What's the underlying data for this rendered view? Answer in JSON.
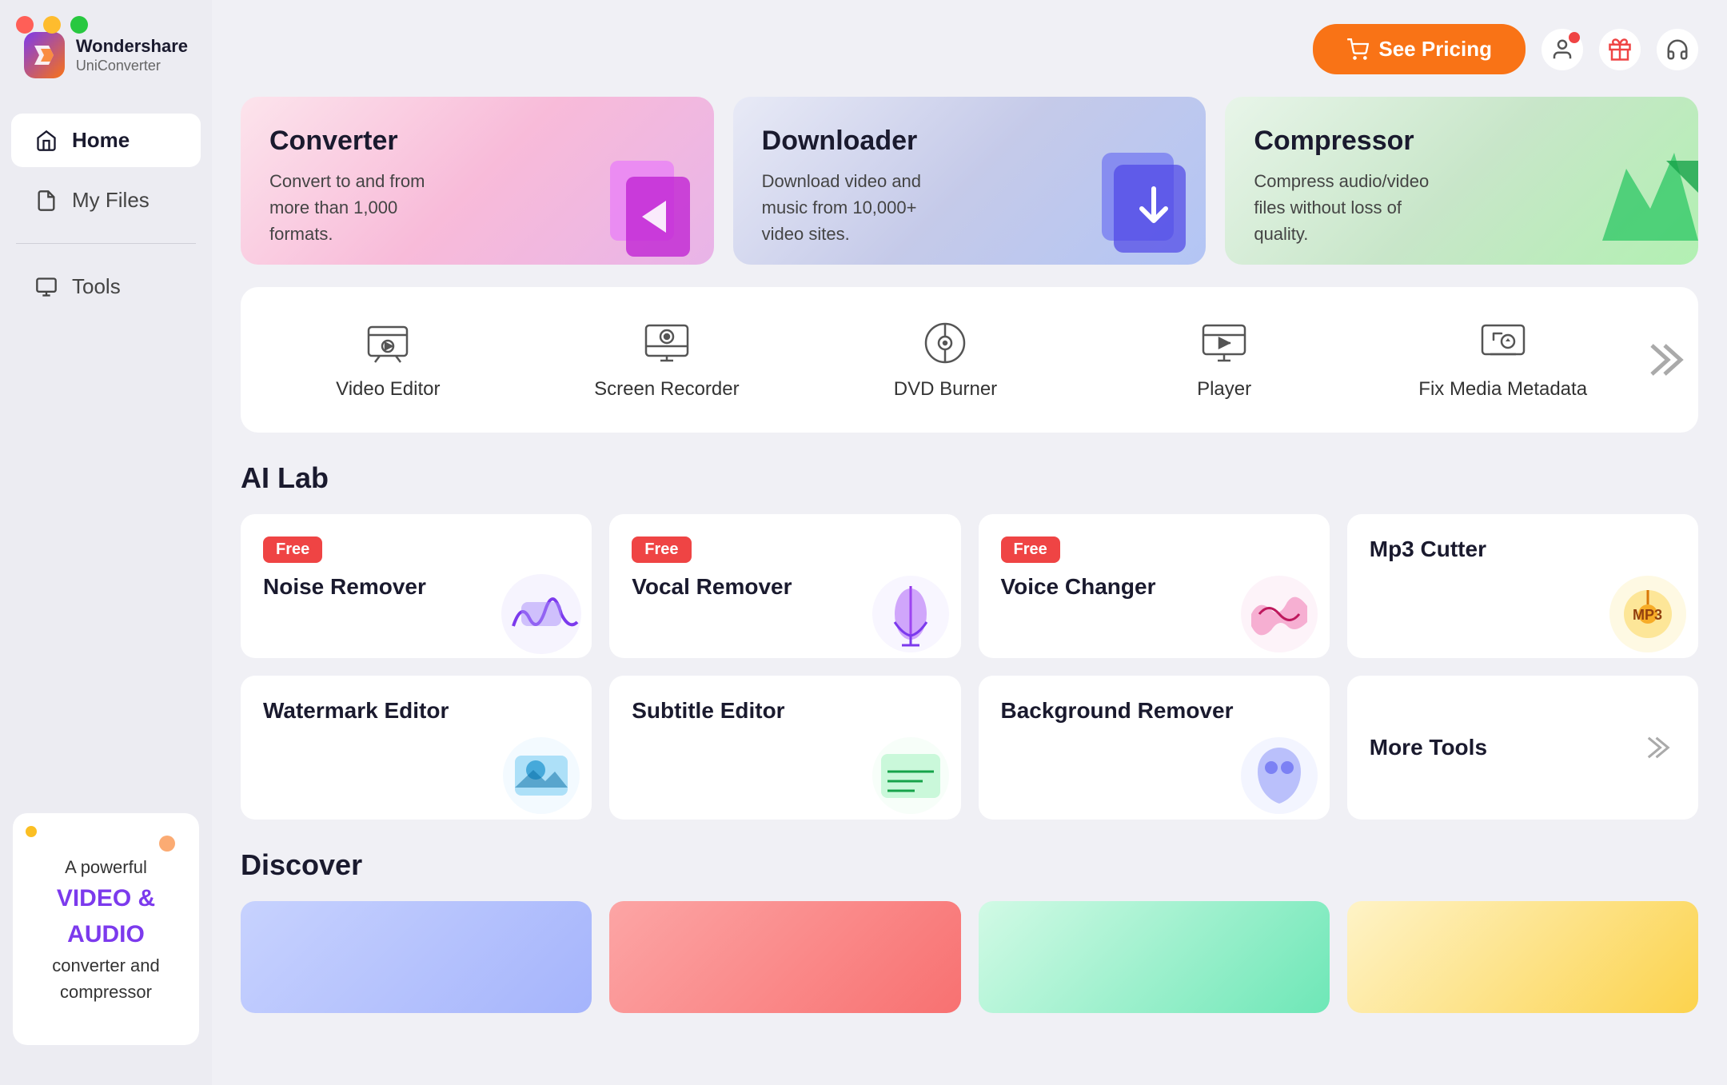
{
  "app": {
    "name": "Wondershare",
    "subname": "UniConverter"
  },
  "topbar": {
    "see_pricing": "See Pricing"
  },
  "sidebar": {
    "items": [
      {
        "id": "home",
        "label": "Home",
        "active": true
      },
      {
        "id": "my-files",
        "label": "My Files",
        "active": false
      },
      {
        "id": "tools",
        "label": "Tools",
        "active": false
      }
    ],
    "ad_line1": "A powerful",
    "ad_line2": "VIDEO &",
    "ad_line3": "AUDIO",
    "ad_line4": "converter and",
    "ad_line5": "compressor"
  },
  "hero": {
    "cards": [
      {
        "id": "converter",
        "title": "Converter",
        "desc": "Convert to and from more than 1,000 formats."
      },
      {
        "id": "downloader",
        "title": "Downloader",
        "desc": "Download video and music from 10,000+ video sites."
      },
      {
        "id": "compressor",
        "title": "Compressor",
        "desc": "Compress audio/video files without loss of quality."
      }
    ]
  },
  "tools": {
    "items": [
      {
        "id": "video-editor",
        "label": "Video Editor"
      },
      {
        "id": "screen-recorder",
        "label": "Screen Recorder"
      },
      {
        "id": "dvd-burner",
        "label": "DVD Burner"
      },
      {
        "id": "player",
        "label": "Player"
      },
      {
        "id": "fix-media",
        "label": "Fix Media Metadata"
      }
    ]
  },
  "ai_lab": {
    "section_title": "AI Lab",
    "row1": [
      {
        "id": "noise-remover",
        "label": "Noise Remover",
        "free": true
      },
      {
        "id": "vocal-remover",
        "label": "Vocal Remover",
        "free": true
      },
      {
        "id": "voice-changer",
        "label": "Voice Changer",
        "free": true
      },
      {
        "id": "mp3-cutter",
        "label": "Mp3 Cutter",
        "free": false
      }
    ],
    "row2": [
      {
        "id": "watermark-editor",
        "label": "Watermark Editor",
        "free": false
      },
      {
        "id": "subtitle-editor",
        "label": "Subtitle Editor",
        "free": false
      },
      {
        "id": "background-remover",
        "label": "Background Remover",
        "free": false
      }
    ],
    "more_tools": "More Tools",
    "free_badge": "Free"
  },
  "discover": {
    "section_title": "Discover"
  }
}
